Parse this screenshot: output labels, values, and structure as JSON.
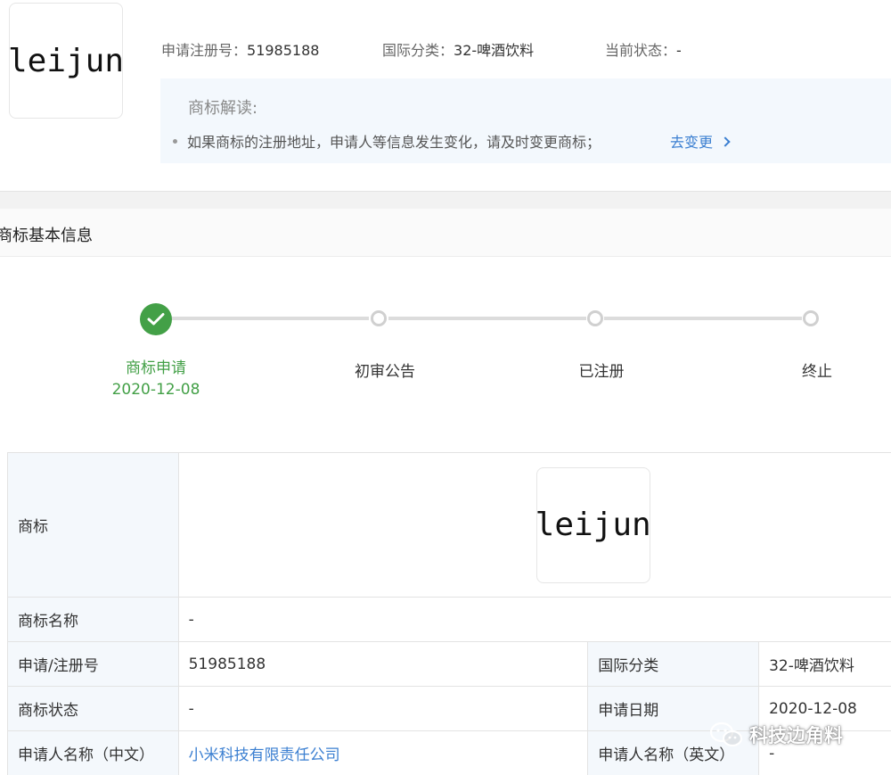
{
  "header": {
    "logo_text": "leijun",
    "reg_no_label": "申请注册号：",
    "reg_no_value": "51985188",
    "intl_class_label": "国际分类：",
    "intl_class_value": "32-啤酒饮料",
    "status_label": "当前状态：",
    "status_value": "-"
  },
  "explain": {
    "title": "商标解读:",
    "item_text": "如果商标的注册地址，申请人等信息发生变化，请及时变更商标；",
    "link_label": "去变更"
  },
  "section": {
    "title": "商标基本信息"
  },
  "progress": {
    "steps": [
      {
        "label": "商标申请",
        "date": "2020-12-08",
        "done": true
      },
      {
        "label": "初审公告"
      },
      {
        "label": "已注册"
      },
      {
        "label": "终止"
      }
    ],
    "done_color": "#43a047"
  },
  "table": {
    "trademark_key": "商标",
    "trademark_logo_text": "leijun",
    "name_key": "商标名称",
    "name_value": "-",
    "reg_no_key": "申请/注册号",
    "reg_no_value": "51985188",
    "intl_class_key": "国际分类",
    "intl_class_value": "32-啤酒饮料",
    "status_key": "商标状态",
    "status_value": "-",
    "apply_date_key": "申请日期",
    "apply_date_value": "2020-12-08",
    "applicant_cn_key": "申请人名称（中文）",
    "applicant_cn_value": "小米科技有限责任公司",
    "applicant_en_key": "申请人名称（英文）",
    "applicant_en_value": "-"
  },
  "watermark": {
    "icon": "wechat-icon",
    "text": "科技边角料"
  },
  "colors": {
    "link": "#3b7fd1",
    "success": "#43a047",
    "key_cell_bg": "#f4f8fc",
    "explain_bg": "#f3f8fd"
  }
}
